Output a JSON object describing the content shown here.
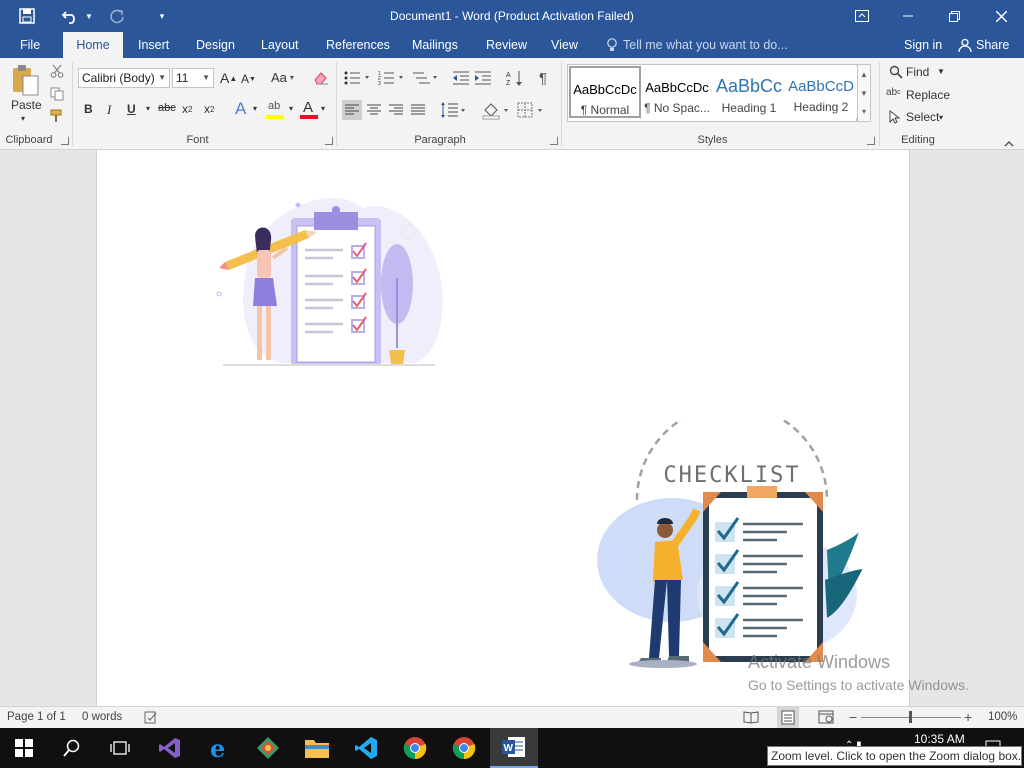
{
  "title": "Document1 - Word (Product Activation Failed)",
  "tabs": [
    "File",
    "Home",
    "Insert",
    "Design",
    "Layout",
    "References",
    "Mailings",
    "Review",
    "View"
  ],
  "tell_me": "Tell me what you want to do...",
  "sign_in": "Sign in",
  "share": "Share",
  "clipboard": {
    "paste": "Paste",
    "label": "Clipboard"
  },
  "font": {
    "name": "Calibri (Body)",
    "size": "11",
    "label": "Font",
    "case": "Aa"
  },
  "paragraph": {
    "label": "Paragraph"
  },
  "styles": {
    "label": "Styles",
    "items": [
      {
        "preview": "AaBbCcDc",
        "name": "¶ Normal"
      },
      {
        "preview": "AaBbCcDc",
        "name": "¶ No Spac..."
      },
      {
        "preview": "AaBbCc",
        "name": "Heading 1"
      },
      {
        "preview": "AaBbCcD",
        "name": "Heading 2"
      }
    ]
  },
  "editing": {
    "find": "Find",
    "replace": "Replace",
    "select": "Select",
    "label": "Editing"
  },
  "document": {
    "checklist_title": "CHECKLIST"
  },
  "status": {
    "page": "Page 1 of 1",
    "words": "0 words",
    "zoom": "100%"
  },
  "watermark": {
    "line1": "Activate Windows",
    "line2": "Go to Settings to activate Windows."
  },
  "clock": "10:35 AM",
  "tooltip": "Zoom level. Click to open the Zoom dialog box.",
  "colors": {
    "accent": "#2b579a",
    "highlight": "#ffff00",
    "font_color": "#e81123"
  }
}
